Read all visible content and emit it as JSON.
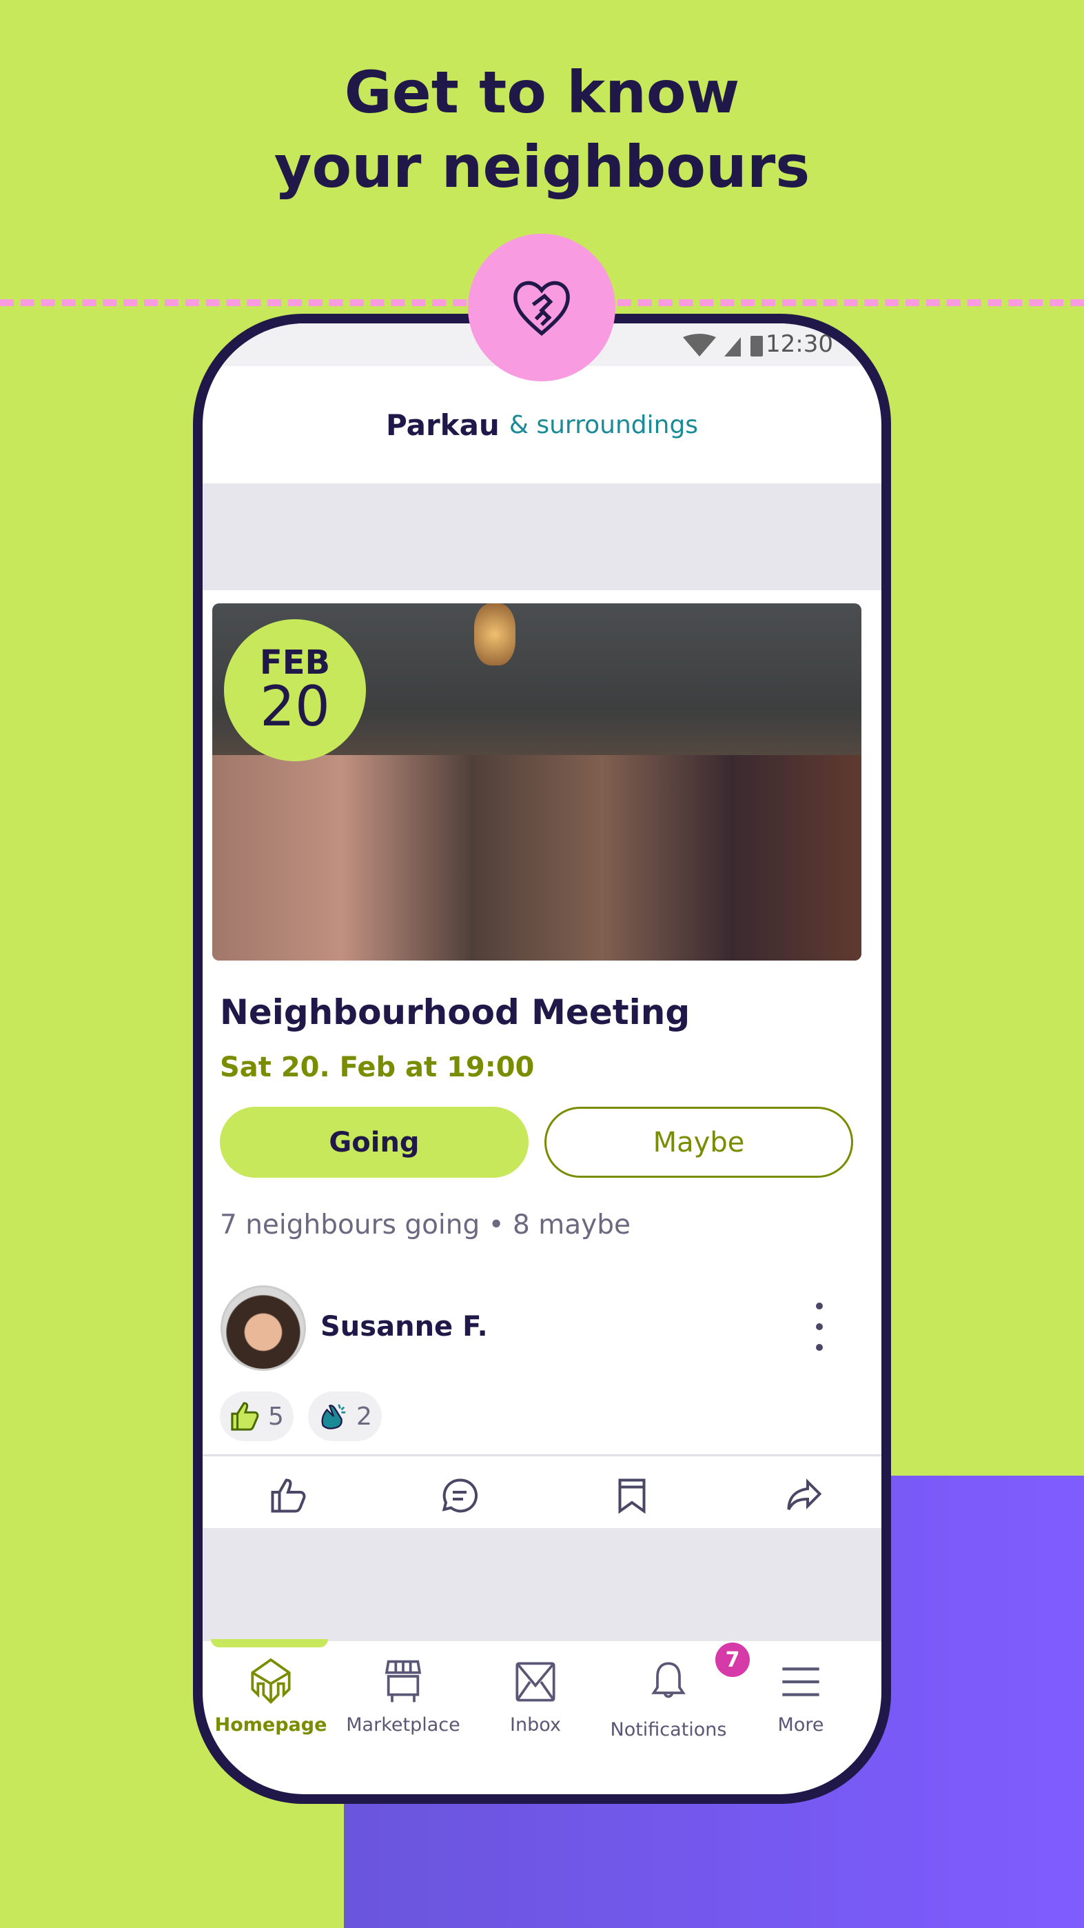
{
  "headline": {
    "line1": "Get to know",
    "line2": "your neighbours"
  },
  "colors": {
    "background": "#c8e85c",
    "accent_pink": "#f99be0",
    "purple": "#7f5cff",
    "olive": "#7a8c00",
    "navy": "#1f1848",
    "badge": "#d63aa8"
  },
  "status_bar": {
    "time": "12:30",
    "icons": [
      "wifi-icon",
      "signal-icon",
      "battery-icon"
    ]
  },
  "header": {
    "town": "Parkau",
    "suffix": "& surroundings"
  },
  "event": {
    "month": "FEB",
    "day": "20",
    "title": "Neighbourhood Meeting",
    "when": "Sat 20. Feb at 19:00",
    "going_label": "Going",
    "maybe_label": "Maybe",
    "stats": "7 neighbours going • 8 maybe"
  },
  "post": {
    "author": "Susanne F.",
    "reactions": [
      {
        "icon": "thumbs-up-icon",
        "count": "5"
      },
      {
        "icon": "clap-icon",
        "count": "2"
      }
    ],
    "actions": [
      "like-icon",
      "comment-icon",
      "bookmark-icon",
      "share-icon"
    ]
  },
  "nav": {
    "items": [
      {
        "label": "Homepage",
        "active": true
      },
      {
        "label": "Marketplace"
      },
      {
        "label": "Inbox"
      },
      {
        "label": "Notifications",
        "badge": "7"
      },
      {
        "label": "More"
      }
    ]
  }
}
